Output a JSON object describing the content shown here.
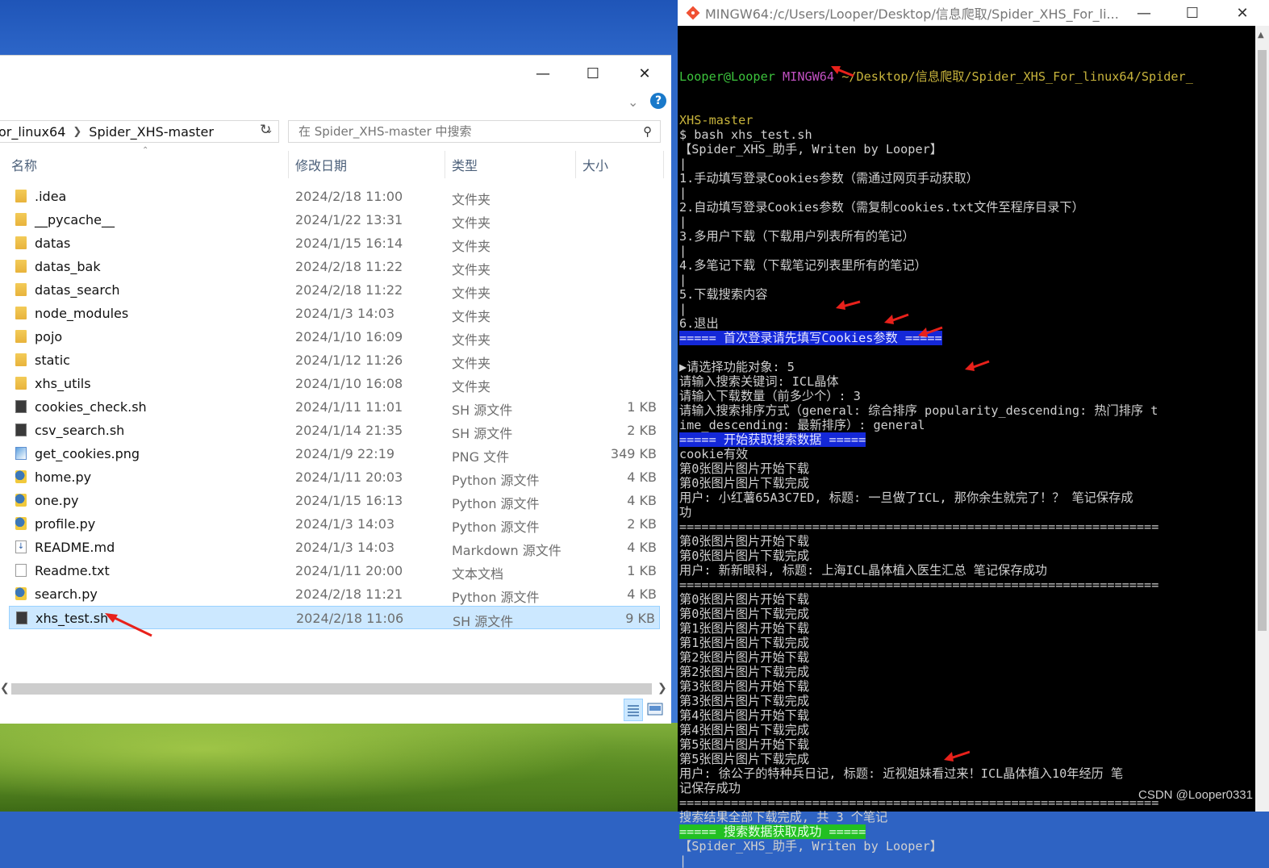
{
  "explorer": {
    "address": [
      "or_linux64",
      "Spider_XHS-master"
    ],
    "search_placeholder": "在 Spider_XHS-master 中搜索",
    "columns": {
      "name": "名称",
      "date": "修改日期",
      "type": "类型",
      "size": "大小"
    },
    "files": [
      {
        "name": ".idea",
        "date": "2024/2/18 11:00",
        "type": "文件夹",
        "size": "",
        "icon": "folder"
      },
      {
        "name": "__pycache__",
        "date": "2024/1/22 13:31",
        "type": "文件夹",
        "size": "",
        "icon": "folder"
      },
      {
        "name": "datas",
        "date": "2024/1/15 16:14",
        "type": "文件夹",
        "size": "",
        "icon": "folder"
      },
      {
        "name": "datas_bak",
        "date": "2024/2/18 11:22",
        "type": "文件夹",
        "size": "",
        "icon": "folder"
      },
      {
        "name": "datas_search",
        "date": "2024/2/18 11:22",
        "type": "文件夹",
        "size": "",
        "icon": "folder"
      },
      {
        "name": "node_modules",
        "date": "2024/1/3 14:03",
        "type": "文件夹",
        "size": "",
        "icon": "folder"
      },
      {
        "name": "pojo",
        "date": "2024/1/10 16:09",
        "type": "文件夹",
        "size": "",
        "icon": "folder"
      },
      {
        "name": "static",
        "date": "2024/1/12 11:26",
        "type": "文件夹",
        "size": "",
        "icon": "folder"
      },
      {
        "name": "xhs_utils",
        "date": "2024/1/10 16:08",
        "type": "文件夹",
        "size": "",
        "icon": "folder"
      },
      {
        "name": "cookies_check.sh",
        "date": "2024/1/11 11:01",
        "type": "SH 源文件",
        "size": "1 KB",
        "icon": "sh"
      },
      {
        "name": "csv_search.sh",
        "date": "2024/1/14 21:35",
        "type": "SH 源文件",
        "size": "2 KB",
        "icon": "sh"
      },
      {
        "name": "get_cookies.png",
        "date": "2024/1/9 22:19",
        "type": "PNG 文件",
        "size": "349 KB",
        "icon": "img"
      },
      {
        "name": "home.py",
        "date": "2024/1/11 20:03",
        "type": "Python 源文件",
        "size": "4 KB",
        "icon": "py"
      },
      {
        "name": "one.py",
        "date": "2024/1/15 16:13",
        "type": "Python 源文件",
        "size": "4 KB",
        "icon": "py"
      },
      {
        "name": "profile.py",
        "date": "2024/1/3 14:03",
        "type": "Python 源文件",
        "size": "2 KB",
        "icon": "py"
      },
      {
        "name": "README.md",
        "date": "2024/1/3 14:03",
        "type": "Markdown 源文件",
        "size": "4 KB",
        "icon": "md"
      },
      {
        "name": "Readme.txt",
        "date": "2024/1/11 20:00",
        "type": "文本文档",
        "size": "1 KB",
        "icon": "doc"
      },
      {
        "name": "search.py",
        "date": "2024/2/18 11:21",
        "type": "Python 源文件",
        "size": "4 KB",
        "icon": "py"
      },
      {
        "name": "xhs_test.sh",
        "date": "2024/2/18 11:06",
        "type": "SH 源文件",
        "size": "9 KB",
        "icon": "sh",
        "selected": true
      }
    ]
  },
  "terminal": {
    "title": "MINGW64:/c/Users/Looper/Desktop/信息爬取/Spider_XHS_For_li...",
    "prompt_user": "Looper@Looper",
    "prompt_sys": "MINGW64",
    "prompt_path": "~/Desktop/信息爬取/Spider_XHS_For_linux64/Spider_",
    "lines": [
      {
        "t": "XHS-master",
        "c": "yellow"
      },
      {
        "t": "$ bash xhs_test.sh",
        "c": ""
      },
      {
        "t": "【Spider_XHS_助手, Writen by Looper】",
        "c": ""
      },
      {
        "t": "|",
        "c": ""
      },
      {
        "t": "1.手动填写登录Cookies参数（需通过网页手动获取）",
        "c": ""
      },
      {
        "t": "|",
        "c": ""
      },
      {
        "t": "2.自动填写登录Cookies参数（需复制cookies.txt文件至程序目录下）",
        "c": ""
      },
      {
        "t": "|",
        "c": ""
      },
      {
        "t": "3.多用户下载（下载用户列表所有的笔记）",
        "c": ""
      },
      {
        "t": "|",
        "c": ""
      },
      {
        "t": "4.多笔记下载（下载笔记列表里所有的笔记）",
        "c": ""
      },
      {
        "t": "|",
        "c": ""
      },
      {
        "t": "5.下载搜索内容",
        "c": ""
      },
      {
        "t": "|",
        "c": ""
      },
      {
        "t": "6.退出",
        "c": ""
      },
      {
        "t": "===== 首次登录请先填写Cookies参数 =====",
        "c": "hl-blue"
      },
      {
        "t": "",
        "c": ""
      },
      {
        "t": "▶请选择功能对象: 5",
        "c": ""
      },
      {
        "t": "请输入搜索关键词: ICL晶体",
        "c": ""
      },
      {
        "t": "请输入下载数量（前多少个）: 3",
        "c": ""
      },
      {
        "t": "请输入搜索排序方式（general: 综合排序 popularity_descending: 热门排序 t",
        "c": ""
      },
      {
        "t": "ime_descending: 最新排序）: general",
        "c": ""
      },
      {
        "t": "===== 开始获取搜索数据 =====",
        "c": "hl-blue"
      },
      {
        "t": "cookie有效",
        "c": ""
      },
      {
        "t": "第0张图片图片开始下载",
        "c": ""
      },
      {
        "t": "第0张图片图片下载完成",
        "c": ""
      },
      {
        "t": "用户: 小红薯65A3C7ED, 标题: 一旦做了ICL, 那你余生就完了！？ 笔记保存成",
        "c": ""
      },
      {
        "t": "功",
        "c": ""
      },
      {
        "t": "=================================================================",
        "c": ""
      },
      {
        "t": "第0张图片图片开始下载",
        "c": ""
      },
      {
        "t": "第0张图片图片下载完成",
        "c": ""
      },
      {
        "t": "用户: 新新眼科, 标题: 上海ICL晶体植入医生汇总 笔记保存成功",
        "c": ""
      },
      {
        "t": "=================================================================",
        "c": ""
      },
      {
        "t": "第0张图片图片开始下载",
        "c": ""
      },
      {
        "t": "第0张图片图片下载完成",
        "c": ""
      },
      {
        "t": "第1张图片图片开始下载",
        "c": ""
      },
      {
        "t": "第1张图片图片下载完成",
        "c": ""
      },
      {
        "t": "第2张图片图片开始下载",
        "c": ""
      },
      {
        "t": "第2张图片图片下载完成",
        "c": ""
      },
      {
        "t": "第3张图片图片开始下载",
        "c": ""
      },
      {
        "t": "第3张图片图片下载完成",
        "c": ""
      },
      {
        "t": "第4张图片图片开始下载",
        "c": ""
      },
      {
        "t": "第4张图片图片下载完成",
        "c": ""
      },
      {
        "t": "第5张图片图片开始下载",
        "c": ""
      },
      {
        "t": "第5张图片图片下载完成",
        "c": ""
      },
      {
        "t": "用户: 徐公子的特种兵日记, 标题: 近视姐妹看过来！ICL晶体植入10年经历 笔",
        "c": ""
      },
      {
        "t": "记保存成功",
        "c": ""
      },
      {
        "t": "=================================================================",
        "c": ""
      },
      {
        "t": "搜索结果全部下载完成, 共 3 个笔记",
        "c": ""
      },
      {
        "t": "===== 搜索数据获取成功 =====",
        "c": "hl-green"
      },
      {
        "t": "【Spider_XHS_助手, Writen by Looper】",
        "c": ""
      },
      {
        "t": "|",
        "c": ""
      }
    ],
    "watermark": "CSDN @Looper0331"
  },
  "colors": {
    "terminal_bg": "#000000",
    "selection": "#cce8ff",
    "accent": "#1979ca"
  }
}
